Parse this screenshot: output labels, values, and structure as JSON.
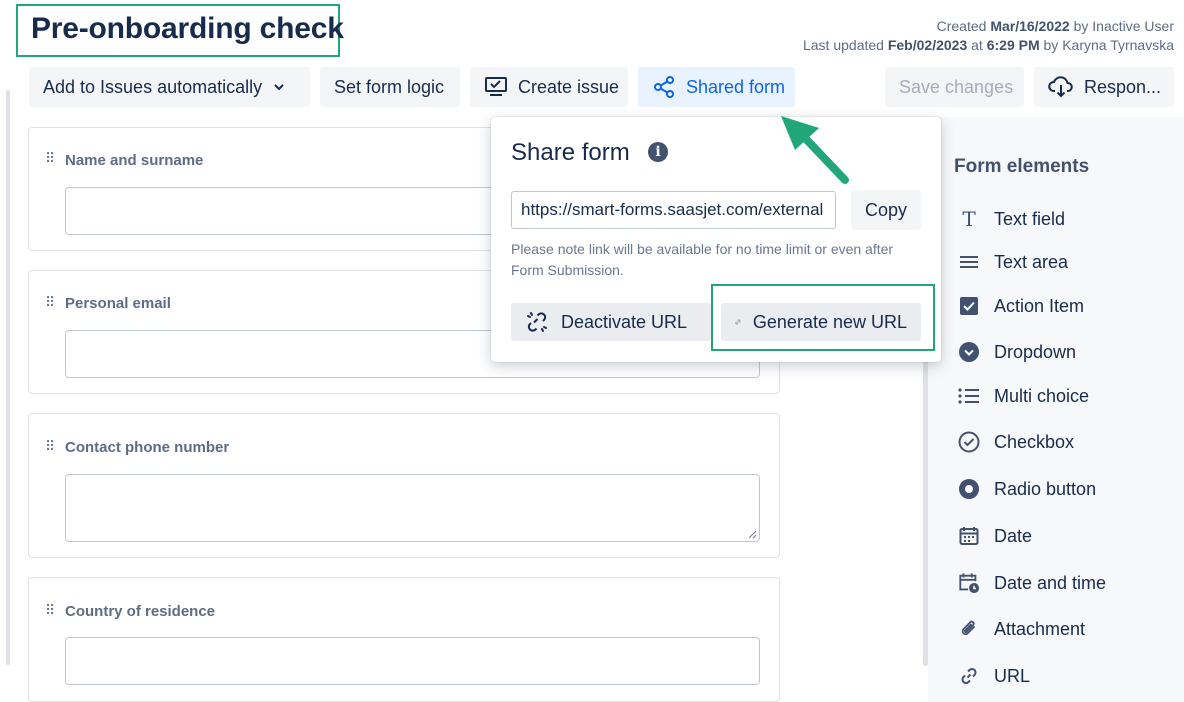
{
  "header": {
    "title": "Pre-onboarding check",
    "created_prefix": "Created",
    "created_date": "Mar/16/2022",
    "created_by_prefix": "by",
    "created_by": "Inactive User",
    "updated_prefix": "Last updated",
    "updated_date": "Feb/02/2023",
    "updated_at_prefix": "at",
    "updated_time": "6:29 PM",
    "updated_by_prefix": "by",
    "updated_by": "Karyna Tyrnavska"
  },
  "toolbar": {
    "add_issues": "Add to Issues automatically",
    "form_logic": "Set form logic",
    "create_issue": "Create issue",
    "shared_form": "Shared form",
    "save_changes": "Save changes",
    "responses": "Respon..."
  },
  "fields": [
    {
      "label": "Name and surname"
    },
    {
      "label": "Personal email"
    },
    {
      "label": "Contact phone number"
    },
    {
      "label": "Country of residence"
    }
  ],
  "share_popup": {
    "title": "Share form",
    "url": "https://smart-forms.saasjet.com/external",
    "copy": "Copy",
    "note": "Please note link will be available for no time limit or even after Form Submission.",
    "deactivate": "Deactivate URL",
    "generate": "Generate new URL"
  },
  "form_elements": {
    "title": "Form elements",
    "items": [
      {
        "label": "Text field",
        "icon": "text-field-icon"
      },
      {
        "label": "Text area",
        "icon": "text-area-icon"
      },
      {
        "label": "Action Item",
        "icon": "action-item-icon"
      },
      {
        "label": "Dropdown",
        "icon": "dropdown-icon"
      },
      {
        "label": "Multi choice",
        "icon": "multi-choice-icon"
      },
      {
        "label": "Checkbox",
        "icon": "checkbox-icon"
      },
      {
        "label": "Radio button",
        "icon": "radio-button-icon"
      },
      {
        "label": "Date",
        "icon": "calendar-icon"
      },
      {
        "label": "Date and time",
        "icon": "calendar-clock-icon"
      },
      {
        "label": "Attachment",
        "icon": "paperclip-icon"
      },
      {
        "label": "URL",
        "icon": "link-icon"
      }
    ]
  },
  "colors": {
    "accent": "#0c66e4",
    "highlight_box": "#21a67a",
    "text": "#172b4d"
  }
}
